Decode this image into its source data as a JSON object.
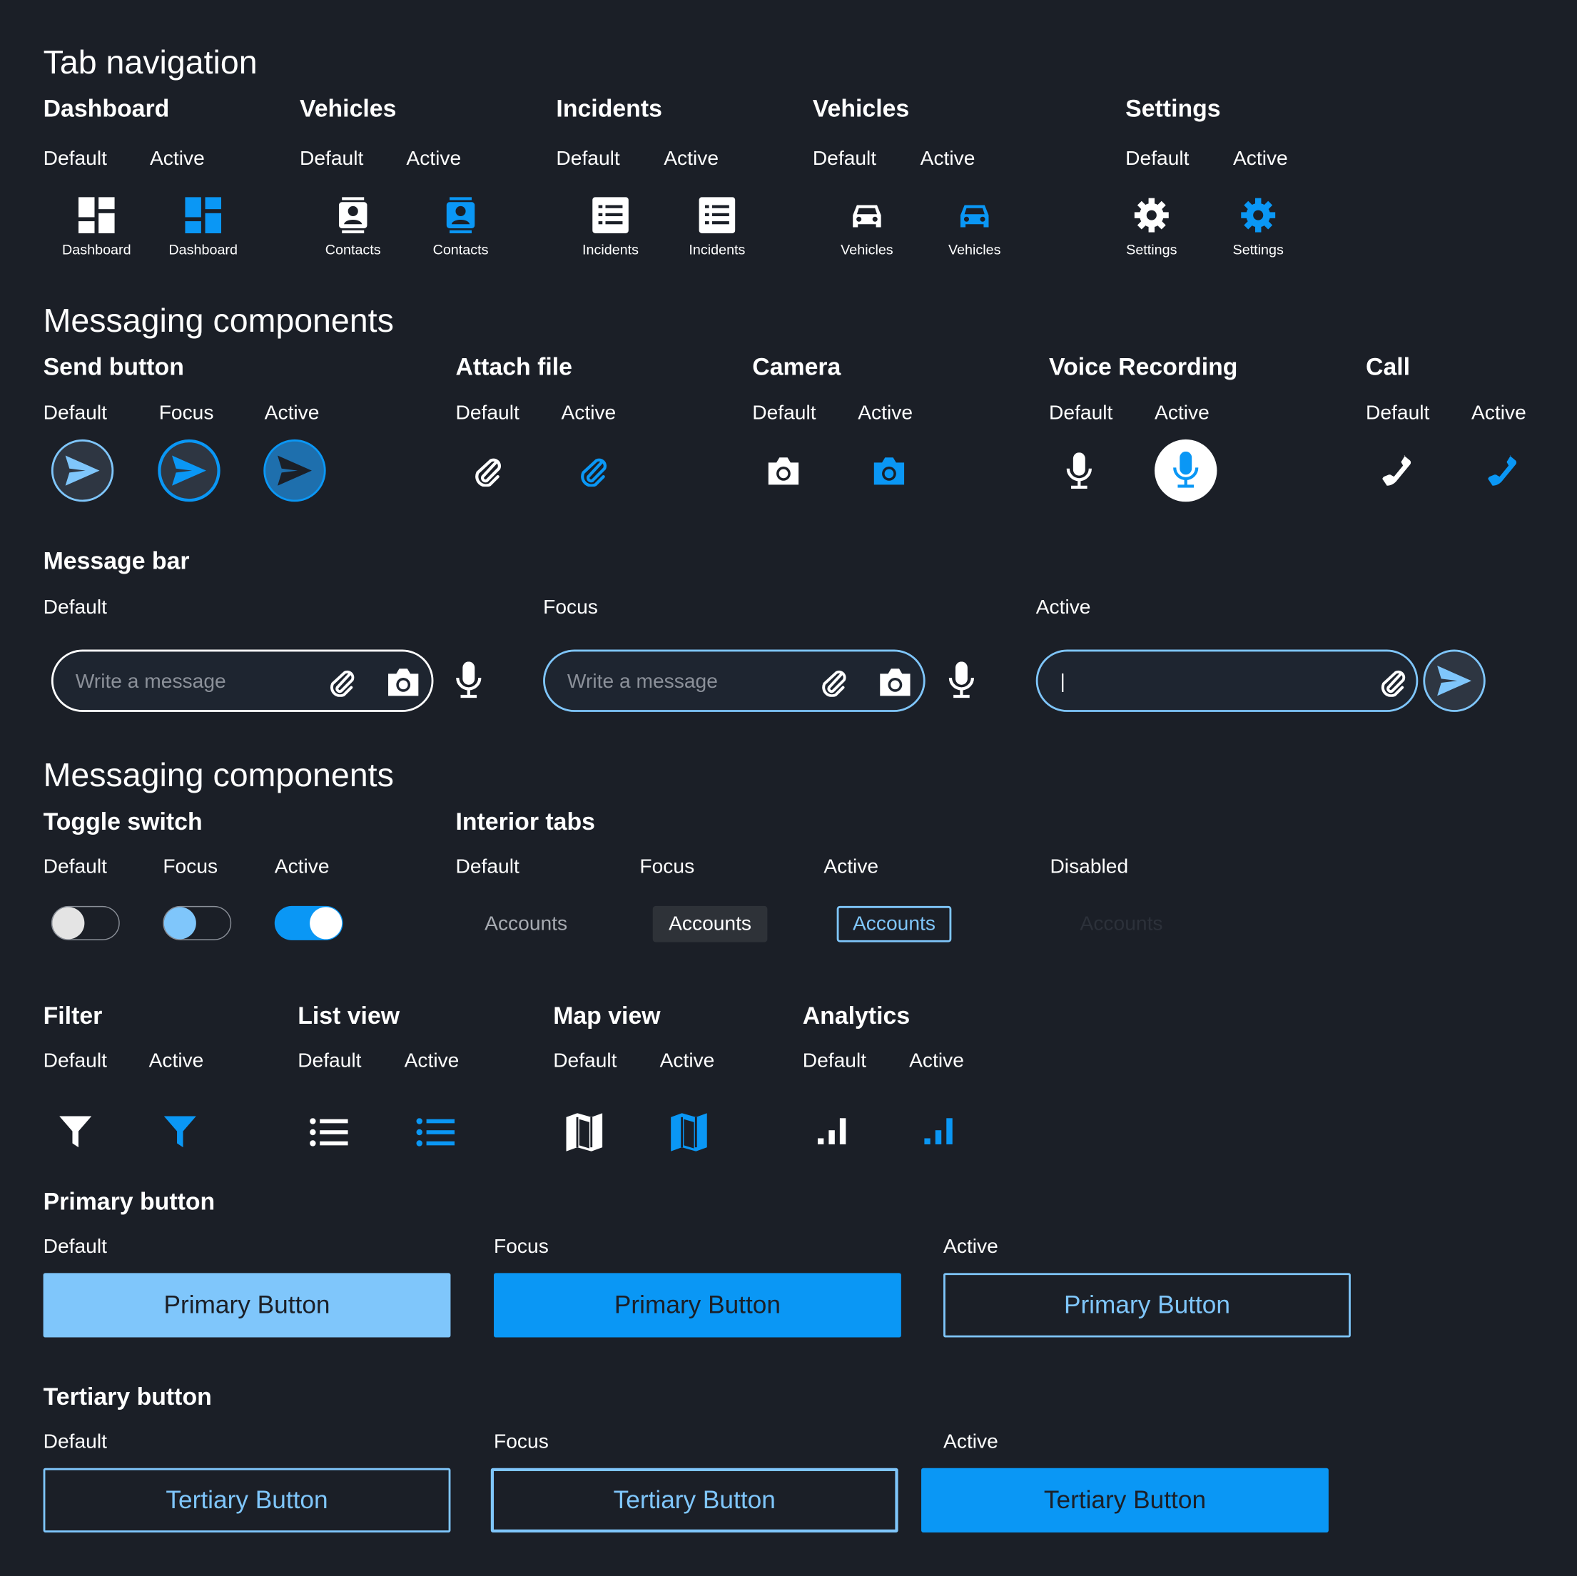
{
  "colors": {
    "background": "#1b1f27",
    "accent": "#0a97f5",
    "accent_light": "#7fc6fb",
    "text": "#ffffff"
  },
  "tab_navigation": {
    "title": "Tab navigation",
    "groups": [
      {
        "title": "Dashboard",
        "default_label": "Default",
        "active_label": "Active",
        "icon": "dashboard-icon",
        "caption_default": "Dashboard",
        "caption_active": "Dashboard"
      },
      {
        "title": "Vehicles",
        "default_label": "Default",
        "active_label": "Active",
        "icon": "contacts-icon",
        "caption_default": "Contacts",
        "caption_active": "Contacts"
      },
      {
        "title": "Incidents",
        "default_label": "Default",
        "active_label": "Active",
        "icon": "incidents-icon",
        "caption_default": "Incidents",
        "caption_active": "Incidents"
      },
      {
        "title": "Vehicles",
        "default_label": "Default",
        "active_label": "Active",
        "icon": "vehicles-icon",
        "caption_default": "Vehicles",
        "caption_active": "Vehicles"
      },
      {
        "title": "Settings",
        "default_label": "Default",
        "active_label": "Active",
        "icon": "settings-icon",
        "caption_default": "Settings",
        "caption_active": "Settings"
      }
    ]
  },
  "messaging1": {
    "title": "Messaging components",
    "send": {
      "title": "Send button",
      "default_label": "Default",
      "focus_label": "Focus",
      "active_label": "Active"
    },
    "attach": {
      "title": "Attach file",
      "default_label": "Default",
      "active_label": "Active"
    },
    "camera": {
      "title": "Camera",
      "default_label": "Default",
      "active_label": "Active"
    },
    "voice": {
      "title": "Voice Recording",
      "default_label": "Default",
      "active_label": "Active"
    },
    "call": {
      "title": "Call",
      "default_label": "Default",
      "active_label": "Active"
    },
    "message_bar": {
      "title": "Message bar",
      "default_label": "Default",
      "focus_label": "Focus",
      "active_label": "Active",
      "placeholder": "Write a message",
      "active_value": "|"
    }
  },
  "messaging2": {
    "title": "Messaging components",
    "toggle": {
      "title": "Toggle switch",
      "default_label": "Default",
      "focus_label": "Focus",
      "active_label": "Active"
    },
    "interior_tabs": {
      "title": "Interior tabs",
      "default_label": "Default",
      "focus_label": "Focus",
      "active_label": "Active",
      "disabled_label": "Disabled",
      "tab_text": "Accounts"
    }
  },
  "views": {
    "filter": {
      "title": "Filter",
      "default_label": "Default",
      "active_label": "Active"
    },
    "list": {
      "title": "List view",
      "default_label": "Default",
      "active_label": "Active"
    },
    "map": {
      "title": "Map view",
      "default_label": "Default",
      "active_label": "Active"
    },
    "analytics": {
      "title": "Analytics",
      "default_label": "Default",
      "active_label": "Active"
    }
  },
  "primary": {
    "title": "Primary button",
    "default_label": "Default",
    "focus_label": "Focus",
    "active_label": "Active",
    "text": "Primary Button"
  },
  "tertiary": {
    "title": "Tertiary button",
    "default_label": "Default",
    "focus_label": "Focus",
    "active_label": "Active",
    "text": "Tertiary Button"
  }
}
